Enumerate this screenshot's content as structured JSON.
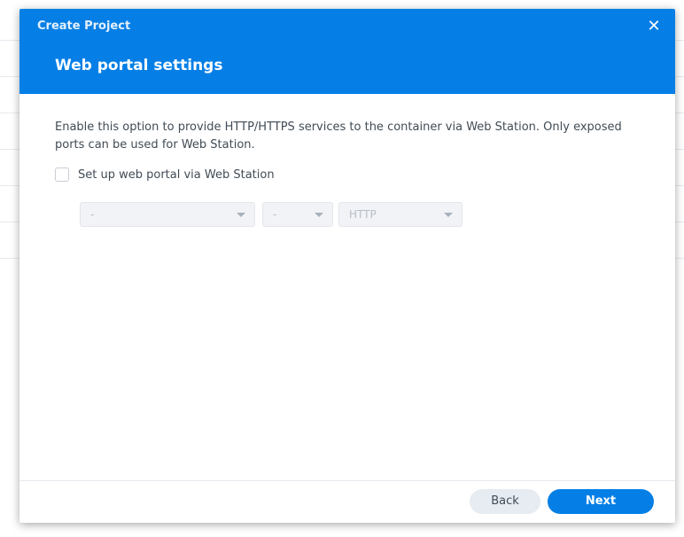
{
  "dialog": {
    "window_title": "Create Project",
    "step_title": "Web portal settings",
    "close_glyph": "✕"
  },
  "content": {
    "description": "Enable this option to provide HTTP/HTTPS services to the container via Web Station. Only exposed ports can be used for Web Station.",
    "checkbox": {
      "label": "Set up web portal via Web Station",
      "checked": false
    },
    "selects": {
      "service": {
        "value": "-",
        "disabled": true
      },
      "port": {
        "value": "-",
        "disabled": true
      },
      "protocol": {
        "value": "HTTP",
        "disabled": true
      }
    }
  },
  "footer": {
    "back_label": "Back",
    "next_label": "Next"
  },
  "colors": {
    "accent": "#057fe6",
    "header_text": "#ffffff",
    "body_text": "#414b55",
    "disabled_text": "#b7bec7"
  },
  "icons": {
    "close": "close-icon",
    "dropdown": "chevron-down-icon"
  }
}
